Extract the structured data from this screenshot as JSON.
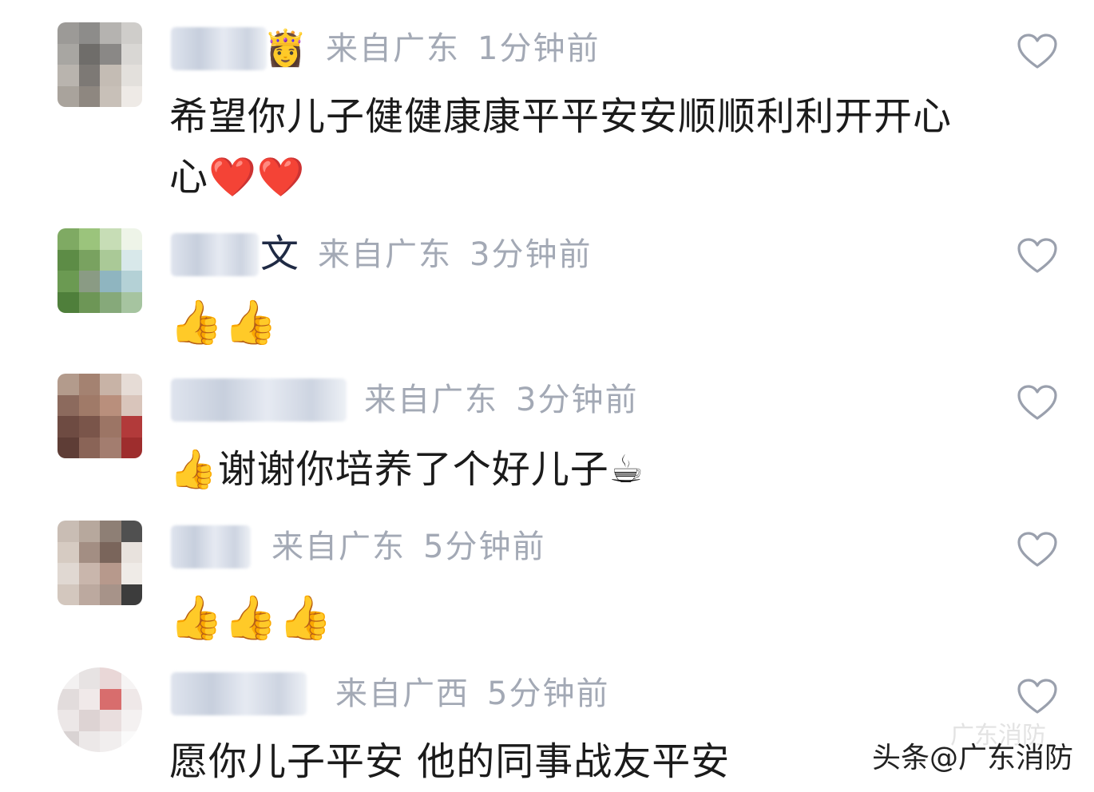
{
  "comments": [
    {
      "name_tail": "",
      "badge": "👸",
      "location": "来自广东",
      "time": "1分钟前",
      "text_lines": [
        "希望你儿子健健康康平平安安顺顺利利开开心",
        "心❤️❤️"
      ]
    },
    {
      "name_tail": "文",
      "badge": "",
      "location": "来自广东",
      "time": "3分钟前",
      "text_lines": [
        "👍👍"
      ]
    },
    {
      "name_tail": "",
      "badge": "",
      "location": "来自广东",
      "time": "3分钟前",
      "text_lines": [
        "👍谢谢你培养了个好儿子☕"
      ]
    },
    {
      "name_tail": "",
      "badge": "",
      "location": "来自广东",
      "time": "5分钟前",
      "text_lines": [
        "👍👍👍"
      ]
    },
    {
      "name_tail": "",
      "badge": "",
      "location": "来自广西",
      "time": "5分钟前",
      "text_lines": [
        "愿你儿子平安 他的同事战友平安"
      ]
    }
  ],
  "icons": {
    "like": "heart-outline-icon"
  },
  "colors": {
    "meta": "#a3a9b5",
    "text": "#1b1b1b",
    "heart_stroke": "#9aa0ad"
  },
  "watermark": {
    "text": "头条@广东消防",
    "ghost": "广东消防"
  }
}
